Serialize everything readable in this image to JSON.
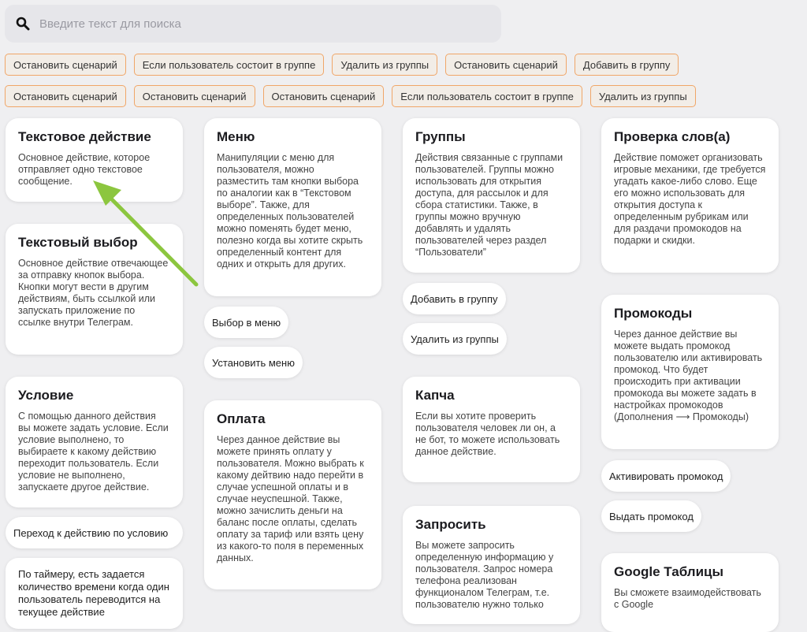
{
  "search": {
    "placeholder": "Введите текст для поиска",
    "icon": "search-icon"
  },
  "chips_row1": [
    "Остановить сценарий",
    "Если пользователь состоит в группе",
    "Удалить из группы",
    "Остановить сценарий",
    "Добавить в группу"
  ],
  "chips_row2": [
    "Остановить сценарий",
    "Остановить сценарий",
    "Остановить сценарий",
    "Если пользователь состоит в группе",
    "Удалить из группы"
  ],
  "cards": {
    "text_action": {
      "title": "Текстовое действие",
      "desc": "Основное действие, которое отправляет одно текстовое сообщение."
    },
    "text_choice": {
      "title": "Текстовый выбор",
      "desc": "Основное действие отвечающее за отправку кнопок выбора. Кнопки могут вести в другим действиям, быть ссылкой или запускать приложение по ссылке внутри Телеграм."
    },
    "condition": {
      "title": "Условие",
      "desc": "С помощью данного действия вы можете задать условие. Если условие выполнено, то выбираете к какому действию переходит пользователь. Если условие не выполнено, запускаете другое действие."
    },
    "menu": {
      "title": "Меню",
      "desc": "Манипуляции с меню для пользователя, можно разместить там кнопки выбора по аналогии как в “Текстовом выборе”. Также, для определенных пользователей можно поменять будет меню, полезно когда вы хотите скрыть определенный контент для одних и открыть для других."
    },
    "payment": {
      "title": "Оплата",
      "desc": "Через данное действие вы можете принять оплату у пользователя. Можно выбрать к какому дейтвию надо перейти в случае успешной оплаты и в случае неуспешной. Также, можно зачислить деньги на баланс после оплаты, сделать оплату за тариф или взять цену из какого-то поля в переменных данных."
    },
    "groups": {
      "title": "Группы",
      "desc": "Действия связанные с группами пользователей. Группы можно использовать для открытия доступа, для рассылок и для сбора статистики. Также, в группы можно вручную добавлять и удалять пользователей через раздел “Пользователи”"
    },
    "captcha": {
      "title": "Капча",
      "desc": "Если вы хотите проверить пользователя человек ли он, а не бот, то можете использовать данное действие."
    },
    "request": {
      "title": "Запросить",
      "desc": "Вы можете запросить определенную информацию у пользователя. Запрос номера телефона реализован функционалом Телеграм, т.е. пользователю нужно только"
    },
    "word_check": {
      "title": "Проверка слов(а)",
      "desc": "Действие поможет организовать игровые механики, где требуется угадать какое-либо слово. Еще его можно использовать для открытия доступа к определенным рубрикам или для раздачи промокодов на подарки и скидки."
    },
    "promocodes": {
      "title": "Промокоды",
      "desc": "Через данное действие вы можете выдать промокод пользователю или активировать промокод. Что будет происходить при активации промокода вы можете задать в настройках промокодов (Дополнения ⟶ Промокоды)"
    },
    "google_sheets": {
      "title": "Google Таблицы",
      "desc": "Вы сможете взаимодействовать с Google"
    }
  },
  "pills": {
    "goto_condition": "Переход к действию по условию",
    "timer": "По таймеру, есть задается количество времени когда один пользователь переводится на текущее действие",
    "menu_choice": "Выбор в меню",
    "set_menu": "Установить меню",
    "add_group": "Добавить в группу",
    "remove_group": "Удалить из группы",
    "activate_promo": "Активировать промокод",
    "give_promo": "Выдать промокод"
  },
  "colors": {
    "chip_border": "#f0a668",
    "arrow": "#8cc63f",
    "background": "#efeff1"
  }
}
